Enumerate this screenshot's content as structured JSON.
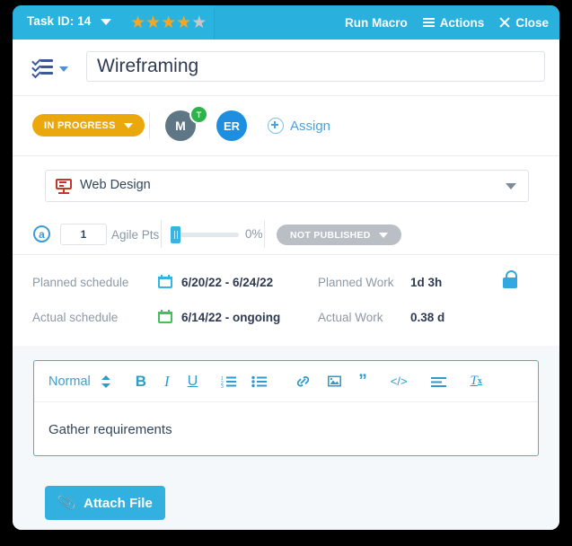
{
  "header": {
    "task_id_label": "Task ID: 14",
    "rating": 4,
    "rating_max": 5,
    "run_macro_label": "Run Macro",
    "actions_label": "Actions",
    "close_label": "Close",
    "bg_color": "#29b0dd"
  },
  "title": {
    "value": "Wireframing",
    "placeholder": "Task name"
  },
  "status": {
    "label": "IN PROGRESS",
    "color": "#eba80d",
    "assignees": [
      {
        "initials": "M",
        "color": "#5f7785",
        "badge": "T"
      },
      {
        "initials": "ER",
        "color": "#1e8fe0"
      }
    ],
    "assign_label": "Assign"
  },
  "project": {
    "name": "Web Design"
  },
  "agile": {
    "points_value": "1",
    "points_label": "Agile Pts",
    "progress_percent": "0%",
    "progress_value": 0,
    "publish_label": "NOT PUBLISHED",
    "publish_color": "#b9bfc5"
  },
  "schedule": {
    "planned_schedule_label": "Planned schedule",
    "planned_schedule_value": "6/20/22 - 6/24/22",
    "actual_schedule_label": "Actual schedule",
    "actual_schedule_value": "6/14/22 - ongoing",
    "planned_work_label": "Planned Work",
    "planned_work_value": "1d 3h",
    "actual_work_label": "Actual Work",
    "actual_work_value": "0.38 d"
  },
  "editor": {
    "format_label": "Normal",
    "bold_label": "B",
    "italic_label": "I",
    "underline_label": "U",
    "quote_label": "”",
    "code_label": "</>",
    "clear_label": "T",
    "clear_sub": "x",
    "content": "Gather requirements"
  },
  "attach": {
    "label": "Attach File",
    "color": "#32b0e0"
  }
}
